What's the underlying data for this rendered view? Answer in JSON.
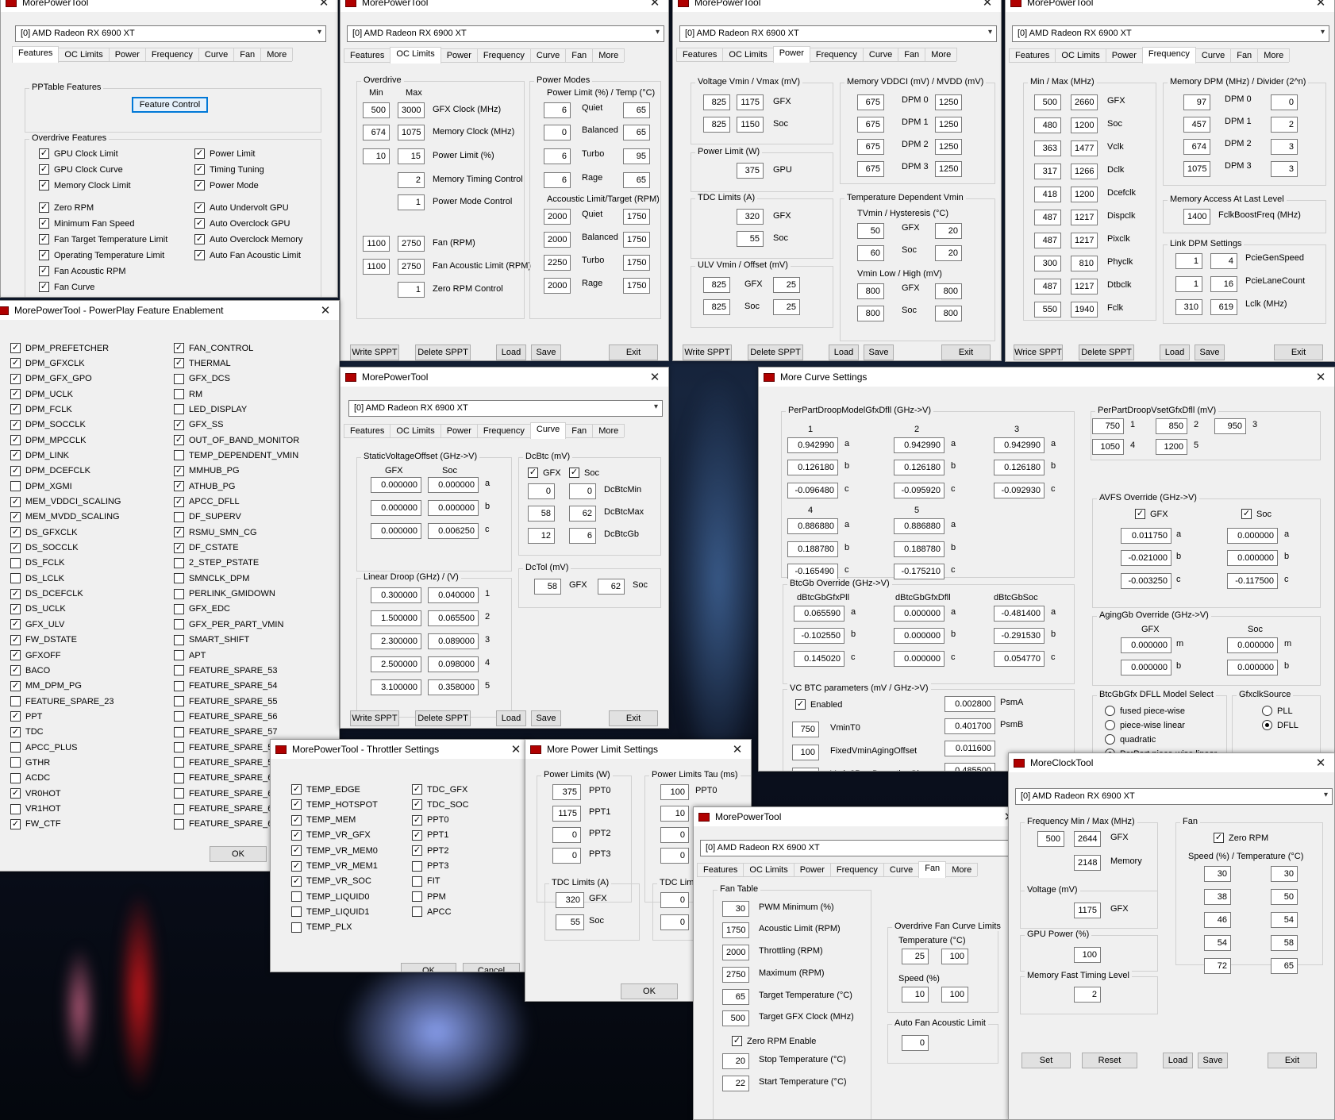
{
  "desktop": {
    "city_wallpaper": "night-city-wallpaper"
  },
  "gpu": "[0] AMD Radeon RX 6900 XT",
  "app_title": "MorePowerTool",
  "common_buttons": {
    "write": "Write SPPT",
    "delete": "Delete SPPT",
    "load": "Load",
    "save": "Save",
    "exit": "Exit",
    "ok": "OK",
    "cancel": "Cancel",
    "set": "Set",
    "reset": "Reset",
    "write_alt": "Wrice SPPT"
  },
  "tabs": [
    "Features",
    "OC Limits",
    "Power",
    "Frequency",
    "Curve",
    "Fan",
    "More"
  ],
  "win_features": {
    "pptable_title": "PPTable Features",
    "feature_control": "Feature Control",
    "overdrive_title": "Overdrive Features",
    "left": [
      "GPU Clock Limit",
      "GPU Clock Curve",
      "Memory Clock Limit",
      "Zero RPM",
      "Minimum Fan Speed",
      "Fan Target Temperature Limit",
      "Operating Temperature Limit",
      "Fan Acoustic RPM",
      "Fan Curve"
    ],
    "right": [
      "Power Limit",
      "Timing Tuning",
      "Power Mode",
      "Auto Undervolt GPU",
      "Auto Overclock GPU",
      "Auto Overclock Memory",
      "Auto Fan Acoustic Limit"
    ]
  },
  "win_oc": {
    "overdrive": "Overdrive",
    "min": "Min",
    "max": "Max",
    "rows": [
      {
        "min": "500",
        "max": "3000",
        "label": "GFX Clock (MHz)"
      },
      {
        "min": "674",
        "max": "1075",
        "label": "Memory Clock (MHz)"
      },
      {
        "min": "10",
        "max": "15",
        "label": "Power Limit (%)"
      },
      {
        "min": "",
        "max": "2",
        "label": "Memory Timing Control"
      },
      {
        "min": "",
        "max": "1",
        "label": "Power Mode Control"
      },
      {
        "min": "1100",
        "max": "2750",
        "label": "Fan (RPM)"
      },
      {
        "min": "1100",
        "max": "2750",
        "label": "Fan Acoustic Limit (RPM)"
      },
      {
        "min": "",
        "max": "1",
        "label": "Zero RPM Control"
      }
    ],
    "power_modes": "Power Modes",
    "pl_temp": "Power Limit (%) / Temp (°C)",
    "pm": [
      {
        "a": "6",
        "l": "Quiet",
        "b": "65"
      },
      {
        "a": "0",
        "l": "Balanced",
        "b": "65"
      },
      {
        "a": "6",
        "l": "Turbo",
        "b": "95"
      },
      {
        "a": "6",
        "l": "Rage",
        "b": "65"
      }
    ],
    "acoustic": "Accoustic Limit/Target (RPM)",
    "ac": [
      {
        "a": "2000",
        "l": "Quiet",
        "b": "1750"
      },
      {
        "a": "2000",
        "l": "Balanced",
        "b": "1750"
      },
      {
        "a": "2250",
        "l": "Turbo",
        "b": "1750"
      },
      {
        "a": "2000",
        "l": "Rage",
        "b": "1750"
      }
    ]
  },
  "win_power": {
    "voltage_title": "Voltage Vmin / Vmax (mV)",
    "voltage": [
      {
        "a": "825",
        "b": "1175",
        "l": "GFX"
      },
      {
        "a": "825",
        "b": "1150",
        "l": "Soc"
      }
    ],
    "pl_title": "Power Limit (W)",
    "pl": {
      "v": "375",
      "l": "GPU"
    },
    "tdc_title": "TDC Limits (A)",
    "tdc": [
      {
        "v": "320",
        "l": "GFX"
      },
      {
        "v": "55",
        "l": "Soc"
      }
    ],
    "ulv_title": "ULV Vmin / Offset (mV)",
    "ulv": [
      {
        "a": "825",
        "l": "GFX",
        "b": "25"
      },
      {
        "a": "825",
        "l": "Soc",
        "b": "25"
      }
    ],
    "mem_title": "Memory VDDCI (mV) / MVDD (mV)",
    "mem": [
      {
        "a": "675",
        "l": "DPM 0",
        "b": "1250"
      },
      {
        "a": "675",
        "l": "DPM 1",
        "b": "1250"
      },
      {
        "a": "675",
        "l": "DPM 2",
        "b": "1250"
      },
      {
        "a": "675",
        "l": "DPM 3",
        "b": "1250"
      }
    ],
    "tdv_title": "Temperature Dependent Vmin",
    "tvmin_title": "TVmin / Hysteresis (°C)",
    "tvmin": [
      {
        "a": "50",
        "l": "GFX",
        "b": "20"
      },
      {
        "a": "60",
        "l": "Soc",
        "b": "20"
      }
    ],
    "vmin_lh_title": "Vmin Low / High (mV)",
    "vmin_lh": [
      {
        "a": "800",
        "l": "GFX",
        "b": "800"
      },
      {
        "a": "800",
        "l": "Soc",
        "b": "800"
      }
    ]
  },
  "win_freq": {
    "minmax_title": "Min / Max (MHz)",
    "rows": [
      {
        "a": "500",
        "b": "2660",
        "l": "GFX"
      },
      {
        "a": "480",
        "b": "1200",
        "l": "Soc"
      },
      {
        "a": "363",
        "b": "1477",
        "l": "Vclk"
      },
      {
        "a": "317",
        "b": "1266",
        "l": "Dclk"
      },
      {
        "a": "418",
        "b": "1200",
        "l": "Dcefclk"
      },
      {
        "a": "487",
        "b": "1217",
        "l": "Dispclk"
      },
      {
        "a": "487",
        "b": "1217",
        "l": "Pixclk"
      },
      {
        "a": "300",
        "b": "810",
        "l": "Phyclk"
      },
      {
        "a": "487",
        "b": "1217",
        "l": "Dtbclk"
      },
      {
        "a": "550",
        "b": "1940",
        "l": "Fclk"
      }
    ],
    "mdpm_title": "Memory DPM (MHz) / Divider (2^n)",
    "mdpm": [
      {
        "a": "97",
        "l": "DPM 0",
        "b": "0"
      },
      {
        "a": "457",
        "l": "DPM 1",
        "b": "2"
      },
      {
        "a": "674",
        "l": "DPM 2",
        "b": "3"
      },
      {
        "a": "1075",
        "l": "DPM 3",
        "b": "3"
      }
    ],
    "mal_title": "Memory Access At Last Level",
    "mal": {
      "v": "1400",
      "l": "FclkBoostFreq (MHz)"
    },
    "link_title": "Link DPM Settings",
    "link": [
      {
        "a": "1",
        "b": "4",
        "l": "PcieGenSpeed"
      },
      {
        "a": "1",
        "b": "16",
        "l": "PcieLaneCount"
      },
      {
        "a": "310",
        "b": "619",
        "l": "Lclk (MHz)"
      }
    ]
  },
  "win_ppfeat": {
    "title": "MorePowerTool - PowerPlay Feature Enablement",
    "left": [
      [
        "DPM_PREFETCHER",
        true
      ],
      [
        "DPM_GFXCLK",
        true
      ],
      [
        "DPM_GFX_GPO",
        true
      ],
      [
        "DPM_UCLK",
        true
      ],
      [
        "DPM_FCLK",
        true
      ],
      [
        "DPM_SOCCLK",
        true
      ],
      [
        "DPM_MPCCLK",
        true
      ],
      [
        "DPM_LINK",
        true
      ],
      [
        "DPM_DCEFCLK",
        true
      ],
      [
        "DPM_XGMI",
        false
      ],
      [
        "MEM_VDDCI_SCALING",
        true
      ],
      [
        "MEM_MVDD_SCALING",
        true
      ],
      [
        "DS_GFXCLK",
        true
      ],
      [
        "DS_SOCCLK",
        true
      ],
      [
        "DS_FCLK",
        false
      ],
      [
        "DS_LCLK",
        false
      ],
      [
        "DS_DCEFCLK",
        true
      ],
      [
        "DS_UCLK",
        true
      ],
      [
        "GFX_ULV",
        true
      ],
      [
        "FW_DSTATE",
        true
      ],
      [
        "GFXOFF",
        true
      ],
      [
        "BACO",
        true
      ],
      [
        "MM_DPM_PG",
        true
      ],
      [
        "FEATURE_SPARE_23",
        false
      ],
      [
        "PPT",
        true
      ],
      [
        "TDC",
        true
      ],
      [
        "APCC_PLUS",
        false
      ],
      [
        "GTHR",
        false
      ],
      [
        "ACDC",
        false
      ],
      [
        "VR0HOT",
        true
      ],
      [
        "VR1HOT",
        false
      ],
      [
        "FW_CTF",
        true
      ]
    ],
    "right": [
      [
        "FAN_CONTROL",
        true
      ],
      [
        "THERMAL",
        true
      ],
      [
        "GFX_DCS",
        false
      ],
      [
        "RM",
        false
      ],
      [
        "LED_DISPLAY",
        false
      ],
      [
        "GFX_SS",
        true
      ],
      [
        "OUT_OF_BAND_MONITOR",
        true
      ],
      [
        "TEMP_DEPENDENT_VMIN",
        false
      ],
      [
        "MMHUB_PG",
        true
      ],
      [
        "ATHUB_PG",
        true
      ],
      [
        "APCC_DFLL",
        true
      ],
      [
        "DF_SUPERV",
        false
      ],
      [
        "RSMU_SMN_CG",
        true
      ],
      [
        "DF_CSTATE",
        true
      ],
      [
        "2_STEP_PSTATE",
        false
      ],
      [
        "SMNCLK_DPM",
        false
      ],
      [
        "PERLINK_GMIDOWN",
        false
      ],
      [
        "GFX_EDC",
        false
      ],
      [
        "GFX_PER_PART_VMIN",
        false
      ],
      [
        "SMART_SHIFT",
        false
      ],
      [
        "APT",
        false
      ],
      [
        "FEATURE_SPARE_53",
        false
      ],
      [
        "FEATURE_SPARE_54",
        false
      ],
      [
        "FEATURE_SPARE_55",
        false
      ],
      [
        "FEATURE_SPARE_56",
        false
      ],
      [
        "FEATURE_SPARE_57",
        false
      ],
      [
        "FEATURE_SPARE_58",
        false
      ],
      [
        "FEATURE_SPARE_59",
        false
      ],
      [
        "FEATURE_SPARE_60",
        false
      ],
      [
        "FEATURE_SPARE_61",
        false
      ],
      [
        "FEATURE_SPARE_62",
        false
      ],
      [
        "FEATURE_SPARE_63",
        false
      ]
    ]
  },
  "win_curve": {
    "svo_title": "StaticVoltageOffset (GHz->V)",
    "gfx": "GFX",
    "soc": "Soc",
    "svo": [
      {
        "a": "0.000000",
        "b": "0.000000",
        "l": "a"
      },
      {
        "a": "0.000000",
        "b": "0.000000",
        "l": "b"
      },
      {
        "a": "0.000000",
        "b": "0.006250",
        "l": "c"
      }
    ],
    "ld_title": "Linear Droop (GHz) / (V)",
    "ld": [
      {
        "a": "0.300000",
        "b": "0.040000",
        "l": "1"
      },
      {
        "a": "1.500000",
        "b": "0.065500",
        "l": "2"
      },
      {
        "a": "2.300000",
        "b": "0.089000",
        "l": "3"
      },
      {
        "a": "2.500000",
        "b": "0.098000",
        "l": "4"
      },
      {
        "a": "3.100000",
        "b": "0.358000",
        "l": "5"
      }
    ],
    "dcbtc_title": "DcBtc (mV)",
    "dcbtc": [
      {
        "a": "0",
        "b": "0",
        "l": "DcBtcMin"
      },
      {
        "a": "58",
        "b": "62",
        "l": "DcBtcMax"
      },
      {
        "a": "12",
        "b": "6",
        "l": "DcBtcGb"
      }
    ],
    "dctol_title": "DcTol (mV)",
    "dctol": {
      "a": "58",
      "la": "GFX",
      "b": "62",
      "lb": "Soc"
    }
  },
  "win_mcurve": {
    "title": "More Curve Settings",
    "ppdm_title": "PerPartDroopModelGfxDfll (GHz->V)",
    "cols": [
      "1",
      "2",
      "3",
      "4",
      "5"
    ],
    "ppdm": {
      "c1": [
        "0.942990",
        "0.126180",
        "-0.096480"
      ],
      "c2": [
        "0.942990",
        "0.126180",
        "-0.095920"
      ],
      "c3": [
        "0.942990",
        "0.126180",
        "-0.092930"
      ],
      "c4": [
        "0.886880",
        "0.188780",
        "-0.165490"
      ],
      "c5": [
        "0.886880",
        "0.188780",
        "-0.175210"
      ]
    },
    "abc": [
      "a",
      "b",
      "c"
    ],
    "mb": [
      "m",
      "b"
    ],
    "ppv_title": "PerPartDroopVsetGfxDfll (mV)",
    "ppv": [
      {
        "v": "750",
        "l": "1"
      },
      {
        "v": "850",
        "l": "2"
      },
      {
        "v": "950",
        "l": "3"
      },
      {
        "v": "1050",
        "l": "4"
      },
      {
        "v": "1200",
        "l": "5"
      }
    ],
    "avfs_title": "AVFS Override (GHz->V)",
    "avfs_gfx": [
      "0.011750",
      "-0.021000",
      "-0.003250"
    ],
    "avfs_soc": [
      "0.000000",
      "0.000000",
      "-0.117500"
    ],
    "btc_title": "BtcGb Override (GHz->V)",
    "btc_cols": [
      "dBtcGbGfxPll",
      "dBtcGbGfxDfll",
      "dBtcGbSoc"
    ],
    "btc": {
      "c1": [
        "0.065590",
        "-0.102550",
        "0.145020"
      ],
      "c2": [
        "0.000000",
        "0.000000",
        "0.000000"
      ],
      "c3": [
        "-0.481400",
        "-0.291530",
        "0.054770"
      ]
    },
    "aging_title": "AgingGb Override (GHz->V)",
    "aging_gfx": [
      "0.000000",
      "0.000000"
    ],
    "aging_soc": [
      "0.000000",
      "0.000000"
    ],
    "vcbtc_title": "VC BTC parameters (mV / GHz->V)",
    "enabled": "Enabled",
    "vcbtc_left": [
      {
        "v": "750",
        "l": "VminT0"
      },
      {
        "v": "100",
        "l": "FixedVminAgingOffset"
      },
      {
        "v": "0",
        "l": "Vmin2PsmDegrationGb"
      }
    ],
    "vcbtc_right": [
      {
        "v": "0.002800",
        "l": "PsmA"
      },
      {
        "v": "0.401700",
        "l": "PsmB"
      },
      {
        "v": "0.011600",
        "l": ""
      },
      {
        "v": "0.485500",
        "l": ""
      }
    ],
    "dfll_title": "BtcGbGfx DFLL Model Select",
    "dfll": [
      "fused piece-wise",
      "piece-wise linear",
      "quadratic",
      "PerPart piece-wise linear"
    ],
    "gfxclk_title": "GfxclkSource",
    "gfxclk": [
      "PLL",
      "DFLL"
    ]
  },
  "win_throttle": {
    "title": "MorePowerTool - Throttler Settings",
    "left": [
      [
        "TEMP_EDGE",
        true
      ],
      [
        "TEMP_HOTSPOT",
        true
      ],
      [
        "TEMP_MEM",
        true
      ],
      [
        "TEMP_VR_GFX",
        true
      ],
      [
        "TEMP_VR_MEM0",
        true
      ],
      [
        "TEMP_VR_MEM1",
        true
      ],
      [
        "TEMP_VR_SOC",
        true
      ],
      [
        "TEMP_LIQUID0",
        false
      ],
      [
        "TEMP_LIQUID1",
        false
      ],
      [
        "TEMP_PLX",
        false
      ]
    ],
    "right": [
      [
        "TDC_GFX",
        true
      ],
      [
        "TDC_SOC",
        true
      ],
      [
        "PPT0",
        true
      ],
      [
        "PPT1",
        true
      ],
      [
        "PPT2",
        true
      ],
      [
        "PPT3",
        false
      ],
      [
        "FIT",
        false
      ],
      [
        "PPM",
        false
      ],
      [
        "APCC",
        false
      ]
    ]
  },
  "win_mpower": {
    "title": "More Power Limit Settings",
    "pl_title": "Power Limits (W)",
    "pl": [
      {
        "v": "375",
        "l": "PPT0"
      },
      {
        "v": "1175",
        "l": "PPT1"
      },
      {
        "v": "0",
        "l": "PPT2"
      },
      {
        "v": "0",
        "l": "PPT3"
      }
    ],
    "tau_title": "Power Limits Tau (ms)",
    "tau": [
      {
        "v": "100",
        "l": "PPT0"
      },
      {
        "v": "10",
        "l": ""
      },
      {
        "v": "0",
        "l": ""
      },
      {
        "v": "0",
        "l": ""
      }
    ],
    "tdc_title": "TDC Limits (A)",
    "tdc": [
      {
        "v": "320",
        "l": "GFX"
      },
      {
        "v": "55",
        "l": "Soc"
      }
    ],
    "tdc2_title": "TDC Limits",
    "tdc2": [
      "0",
      "0"
    ]
  },
  "win_fan": {
    "fan_table": "Fan Table",
    "rows": [
      {
        "v": "30",
        "l": "PWM Minimum (%)"
      },
      {
        "v": "1750",
        "l": "Acoustic Limit (RPM)"
      },
      {
        "v": "2000",
        "l": "Throttling (RPM)"
      },
      {
        "v": "2750",
        "l": "Maximum (RPM)"
      },
      {
        "v": "65",
        "l": "Target Temperature (°C)"
      },
      {
        "v": "500",
        "l": "Target GFX Clock (MHz)"
      }
    ],
    "zero_rpm": "Zero RPM Enable",
    "stop": {
      "v": "20",
      "l": "Stop Temperature (°C)"
    },
    "start": {
      "v": "22",
      "l": "Start Temperature (°C)"
    },
    "ofcl_title": "Overdrive Fan Curve Limits",
    "temp_label": "Temperature (°C)",
    "temp": [
      "25",
      "100"
    ],
    "speed_label": "Speed (%)",
    "speed": [
      "10",
      "100"
    ],
    "afal_title": "Auto Fan Acoustic Limit",
    "afal": "0"
  },
  "win_clock": {
    "title": "MoreClockTool",
    "freq_title": "Frequency Min / Max (MHz)",
    "freq": {
      "a": "500",
      "b": "2644",
      "l": "GFX",
      "m": "2148",
      "ml": "Memory"
    },
    "volt_title": "Voltage (mV)",
    "volt": {
      "v": "1175",
      "l": "GFX"
    },
    "gpu_title": "GPU Power (%)",
    "gpu": "100",
    "mftl_title": "Memory Fast Timing Level",
    "mftl": "2",
    "fan_title": "Fan",
    "zero_rpm": "Zero RPM",
    "st_title": "Speed (%) / Temperature (°C)",
    "curve": [
      {
        "s": "30",
        "t": "30"
      },
      {
        "s": "38",
        "t": "50"
      },
      {
        "s": "46",
        "t": "54"
      },
      {
        "s": "54",
        "t": "58"
      },
      {
        "s": "72",
        "t": "65"
      }
    ]
  }
}
